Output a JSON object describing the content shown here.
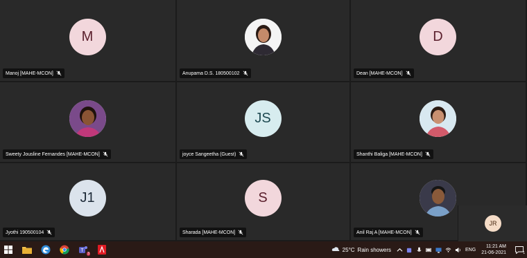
{
  "participants": [
    {
      "name": "Manoj [MAHE-MCON]",
      "initials": "M",
      "avatar_color": "#f2d7dc",
      "avatar_type": "initials",
      "muted": true
    },
    {
      "name": "Anupama D.S. 180500102",
      "initials": "",
      "avatar_type": "photo",
      "muted": true
    },
    {
      "name": "Dean [MAHE-MCON]",
      "initials": "D",
      "avatar_color": "#f2d7dc",
      "avatar_type": "initials",
      "muted": true
    },
    {
      "name": "Sweety Jousline Fernandes [MAHE-MCON]",
      "initials": "",
      "avatar_type": "photo",
      "muted": true
    },
    {
      "name": "joyce Sangeetha (Guest)",
      "initials": "JS",
      "avatar_color": "#d7ecef",
      "avatar_type": "initials",
      "muted": true
    },
    {
      "name": "Shanthi Baliga [MAHE-MCON]",
      "initials": "",
      "avatar_type": "photo",
      "muted": true
    },
    {
      "name": "Jyothi 190500104",
      "initials": "J1",
      "avatar_color": "#dbe3ec",
      "avatar_type": "initials",
      "muted": true
    },
    {
      "name": "Sharada [MAHE-MCON]",
      "initials": "S",
      "avatar_color": "#f2d7dc",
      "avatar_type": "initials",
      "muted": true
    },
    {
      "name": "Anil Raj A [MAHE-MCON]",
      "initials": "",
      "avatar_type": "photo",
      "muted": true
    }
  ],
  "self_view": {
    "initials": "JR"
  },
  "taskbar": {
    "apps": [
      "windows-start-icon",
      "file-explorer-icon",
      "edge-icon",
      "chrome-icon",
      "teams-icon",
      "acrobat-icon"
    ],
    "teams_badge": "3",
    "weather": {
      "temp": "25°C",
      "condition": "Rain showers"
    },
    "language": "ENG",
    "time": "11:21 AM",
    "date": "21-06-2021",
    "notification_badge": "1"
  }
}
